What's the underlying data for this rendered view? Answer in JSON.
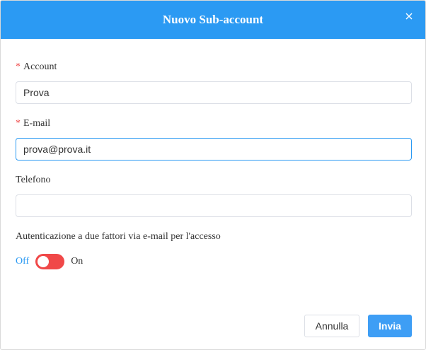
{
  "dialog": {
    "title": "Nuovo Sub-account"
  },
  "fields": {
    "account": {
      "label": "Account",
      "required_mark": "*",
      "value": "Prova"
    },
    "email": {
      "label": "E-mail",
      "required_mark": "*",
      "value": "prova@prova.it"
    },
    "phone": {
      "label": "Telefono",
      "value": ""
    }
  },
  "two_factor": {
    "label": "Autenticazione a due fattori via e-mail per l'accesso",
    "off_label": "Off",
    "on_label": "On",
    "enabled": false
  },
  "buttons": {
    "cancel": "Annulla",
    "submit": "Invia"
  },
  "colors": {
    "header": "#2b9af3",
    "required": "#f04848",
    "switch": "#f04848",
    "primary": "#3e9ef5"
  },
  "icons": {
    "close": "close-icon"
  }
}
